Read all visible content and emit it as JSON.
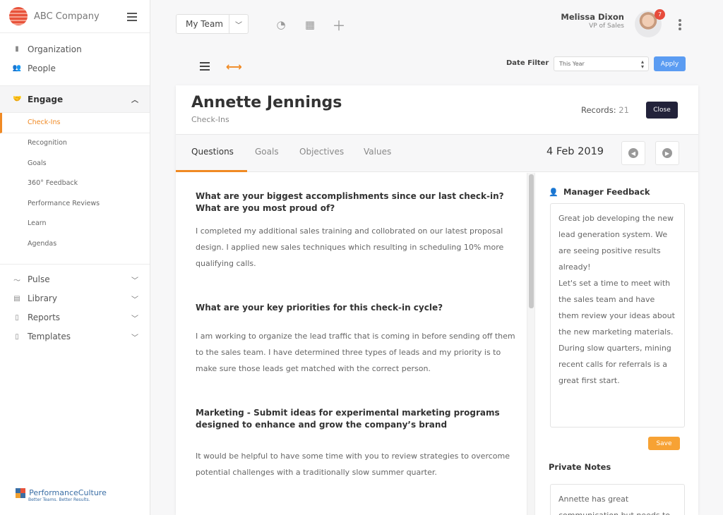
{
  "brand": {
    "name": "ABC Company"
  },
  "sidebar": {
    "top_items": [
      {
        "label": "Organization",
        "icon": "building-icon"
      },
      {
        "label": "People",
        "icon": "people-icon"
      }
    ],
    "engage": {
      "label": "Engage",
      "items": [
        "Check-Ins",
        "Recognition",
        "Goals",
        "360° Feedback",
        "Performance Reviews",
        "Learn",
        "Agendas"
      ]
    },
    "bottom_items": [
      {
        "label": "Pulse",
        "icon": "pulse-icon"
      },
      {
        "label": "Library",
        "icon": "book-icon"
      },
      {
        "label": "Reports",
        "icon": "document-icon"
      },
      {
        "label": "Templates",
        "icon": "document-icon"
      }
    ],
    "footer_logo": {
      "name": "PerformanceCulture",
      "tagline": "Better Teams. Better Results."
    }
  },
  "topbar": {
    "team_select": "My Team",
    "user": {
      "name": "Melissa Dixon",
      "role": "VP of Sales",
      "notifications": "7"
    }
  },
  "toolbar": {
    "date_filter_label": "Date Filter",
    "date_filter_value": "This Year",
    "apply_label": "Apply"
  },
  "card": {
    "person": "Annette Jennings",
    "subtitle": "Check-Ins",
    "records_label": "Records:",
    "records_count": "21",
    "close_label": "Close",
    "tabs": [
      "Questions",
      "Goals",
      "Objectives",
      "Values"
    ],
    "date": "4 Feb 2019"
  },
  "qa": [
    {
      "question": "What are your biggest accomplishments since our last check-in? What are you most proud of?",
      "answer": "I completed my additional sales training and collobrated on our latest proposal design.  I applied new sales techniques which resulting in scheduling 10% more qualifying calls."
    },
    {
      "question": "What are your key priorities for this check-in cycle?",
      "answer": "I am working to organize the lead traffic that is coming in before sending off them to the sales team. I have determined three types of leads and my priority is to make sure those leads get matched with the correct person."
    },
    {
      "question": "Marketing - Submit ideas for experimental marketing programs designed to enhance and grow the company’s brand",
      "answer": "It would be helpful to have some time with you to review strategies to overcome potential challenges with a traditionally slow summer quarter."
    }
  ],
  "feedback": {
    "title": "Manager Feedback",
    "text": "Great job developing the new lead generation system. We are seeing positive results already!\nLet's set a time to meet with the sales team and have them review your ideas about the new marketing materials.\nDuring slow quarters, mining recent calls for referrals is a great first start.",
    "save_label": "Save",
    "private_title": "Private Notes",
    "private_text": "Annette has great communication but needs to"
  }
}
